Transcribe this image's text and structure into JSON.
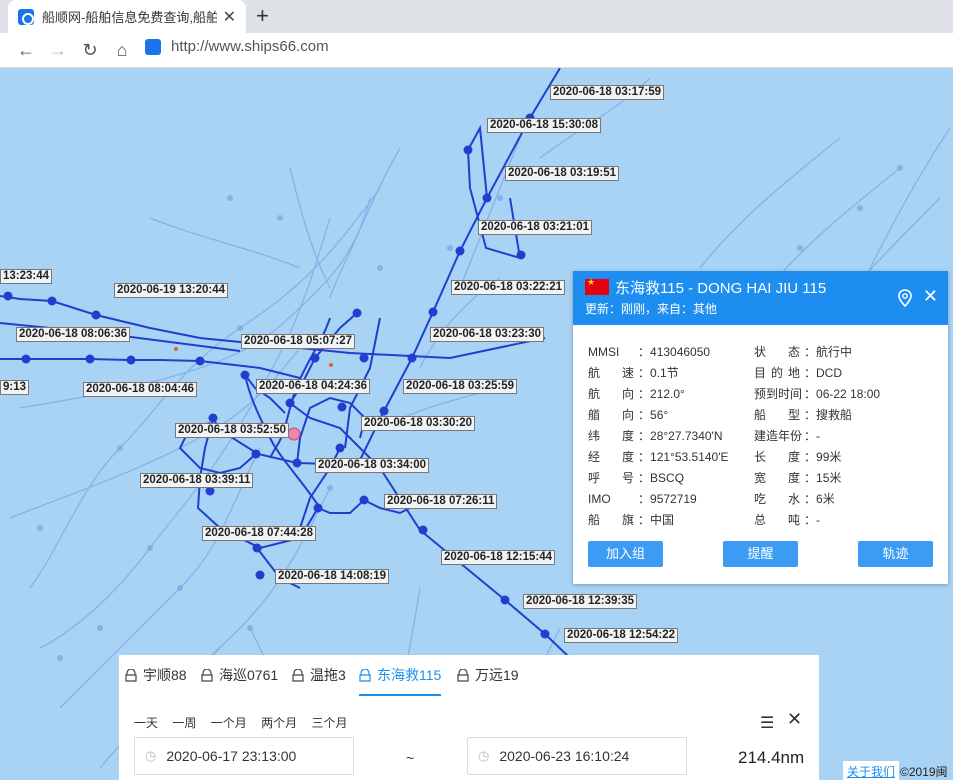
{
  "browser": {
    "tab_title": "船顺网-船舶信息免费查询,船舶动态",
    "url": "http://www.ships66.com"
  },
  "map": {
    "track_labels": [
      "2020-06-18 03:17:59",
      "2020-06-18 15:30:08",
      "2020-06-18 03:19:51",
      "2020-06-18 03:21:01",
      "2020-06-18 03:22:21",
      "2020-06-18 03:23:30",
      "2020-06-18 03:25:59",
      "2020-06-18 03:30:20",
      "2020-06-18 03:34:00",
      "2020-06-18 07:26:11",
      "2020-06-18 12:15:44",
      "2020-06-18 12:39:35",
      "2020-06-18 12:54:22",
      "2020-06-18 05:07:27",
      "2020-06-18 04:24:36",
      "2020-06-18 03:52:50",
      "2020-06-18 03:39:11",
      "2020-06-18 07:44:28",
      "2020-06-18 14:08:19",
      "2020-06-18 08:06:36",
      "2020-06-18 08:04:46",
      "2020-06-19 13:20:44",
      "13:23:44",
      "9:13"
    ]
  },
  "ship": {
    "name": "东海救115 - DONG HAI JIU 115",
    "update": "更新：刚刚，来自：其他",
    "fields_left": [
      {
        "k": "MMSI",
        "v": "413046050"
      },
      {
        "k": "航速",
        "v": "0.1节"
      },
      {
        "k": "航向",
        "v": "212.0°"
      },
      {
        "k": "艏向",
        "v": "56°"
      },
      {
        "k": "纬度",
        "v": "28°27.7340'N"
      },
      {
        "k": "经度",
        "v": "121°53.5140'E"
      },
      {
        "k": "呼号",
        "v": "BSCQ"
      },
      {
        "k": "IMO",
        "v": "9572719"
      },
      {
        "k": "船旗",
        "v": "中国"
      }
    ],
    "fields_right": [
      {
        "k": "状态",
        "v": "航行中"
      },
      {
        "k": "目的地",
        "v": "DCD"
      },
      {
        "k": "预到时间",
        "v": "06-22 18:00"
      },
      {
        "k": "船型",
        "v": "搜救船"
      },
      {
        "k": "建造年份",
        "v": "-"
      },
      {
        "k": "长度",
        "v": "99米"
      },
      {
        "k": "宽度",
        "v": "15米"
      },
      {
        "k": "吃水",
        "v": "6米"
      },
      {
        "k": "总吨",
        "v": "-"
      }
    ],
    "buttons": {
      "join": "加入组",
      "remind": "提醒",
      "track": "轨迹"
    }
  },
  "bottom": {
    "tabs": [
      "宇顺88",
      "海巡0761",
      "温拖3",
      "东海救115",
      "万远19"
    ],
    "active_tab": 3,
    "ranges": [
      "一天",
      "一周",
      "一个月",
      "两个月",
      "三个月"
    ],
    "start": "2020-06-17 23:13:00",
    "tilde": "~",
    "end": "2020-06-23 16:10:24",
    "distance": "214.4nm"
  },
  "footer": {
    "about": "关于我们",
    "copyright": "©2019闽"
  },
  "colors": {
    "track": "#1f3fcf",
    "accent": "#1d8ef0",
    "water": "#a9d3f5"
  }
}
